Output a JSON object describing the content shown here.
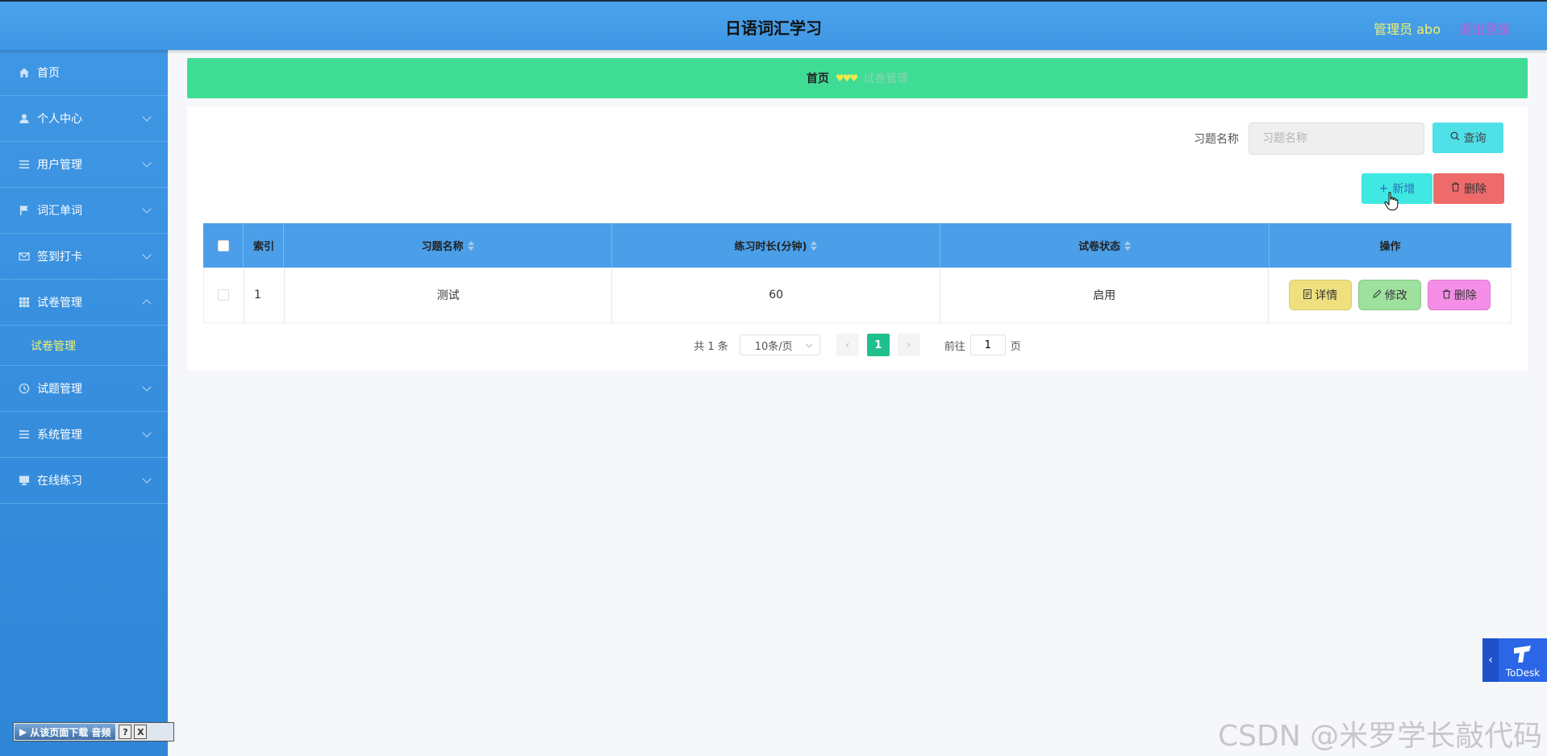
{
  "header": {
    "title": "日语词汇学习",
    "admin": "管理员 abo",
    "logout": "退出登录"
  },
  "sidebar": {
    "items": [
      {
        "label": "首页",
        "icon": "home-icon"
      },
      {
        "label": "个人中心",
        "icon": "user-icon"
      },
      {
        "label": "用户管理",
        "icon": "list-icon"
      },
      {
        "label": "词汇单词",
        "icon": "flag-icon"
      },
      {
        "label": "签到打卡",
        "icon": "mail-icon"
      },
      {
        "label": "试卷管理",
        "icon": "grid-icon"
      },
      {
        "label": "试题管理",
        "icon": "clock-icon"
      },
      {
        "label": "系统管理",
        "icon": "list-icon"
      },
      {
        "label": "在线练习",
        "icon": "monitor-icon"
      }
    ],
    "submenu": {
      "label": "试卷管理"
    }
  },
  "breadcrumb": {
    "home": "首页",
    "separator": "♥♥♥",
    "current": "试卷管理"
  },
  "search": {
    "label": "习题名称",
    "placeholder": "习题名称",
    "query_label": "查询"
  },
  "actions": {
    "add_label": "新增",
    "delete_label": "删除"
  },
  "table": {
    "columns": [
      "索引",
      "习题名称",
      "练习时长(分钟)",
      "试卷状态",
      "操作"
    ],
    "rows": [
      {
        "index": "1",
        "name": "测试",
        "duration": "60",
        "status": "启用"
      }
    ],
    "row_actions": {
      "detail": "详情",
      "edit": "修改",
      "delete": "删除"
    }
  },
  "pagination": {
    "total": "共 1 条",
    "page_size": "10条/页",
    "current_page": "1",
    "goto_prefix": "前往",
    "goto_value": "1",
    "goto_suffix": "页"
  },
  "overlays": {
    "audio_bar": "从该页面下载 音频",
    "audio_help": "?",
    "audio_close": "X",
    "todesk_label": "ToDesk",
    "watermark": "CSDN @米罗学长敲代码"
  },
  "colors": {
    "header_bg": "#4aa3ec",
    "sidebar_bg": "#3f97e4",
    "breadcrumb_bg": "#3fdc95",
    "table_header_bg": "#4a9fe8",
    "accent_yellow": "#f3f06b",
    "page_active": "#1fc08e"
  }
}
